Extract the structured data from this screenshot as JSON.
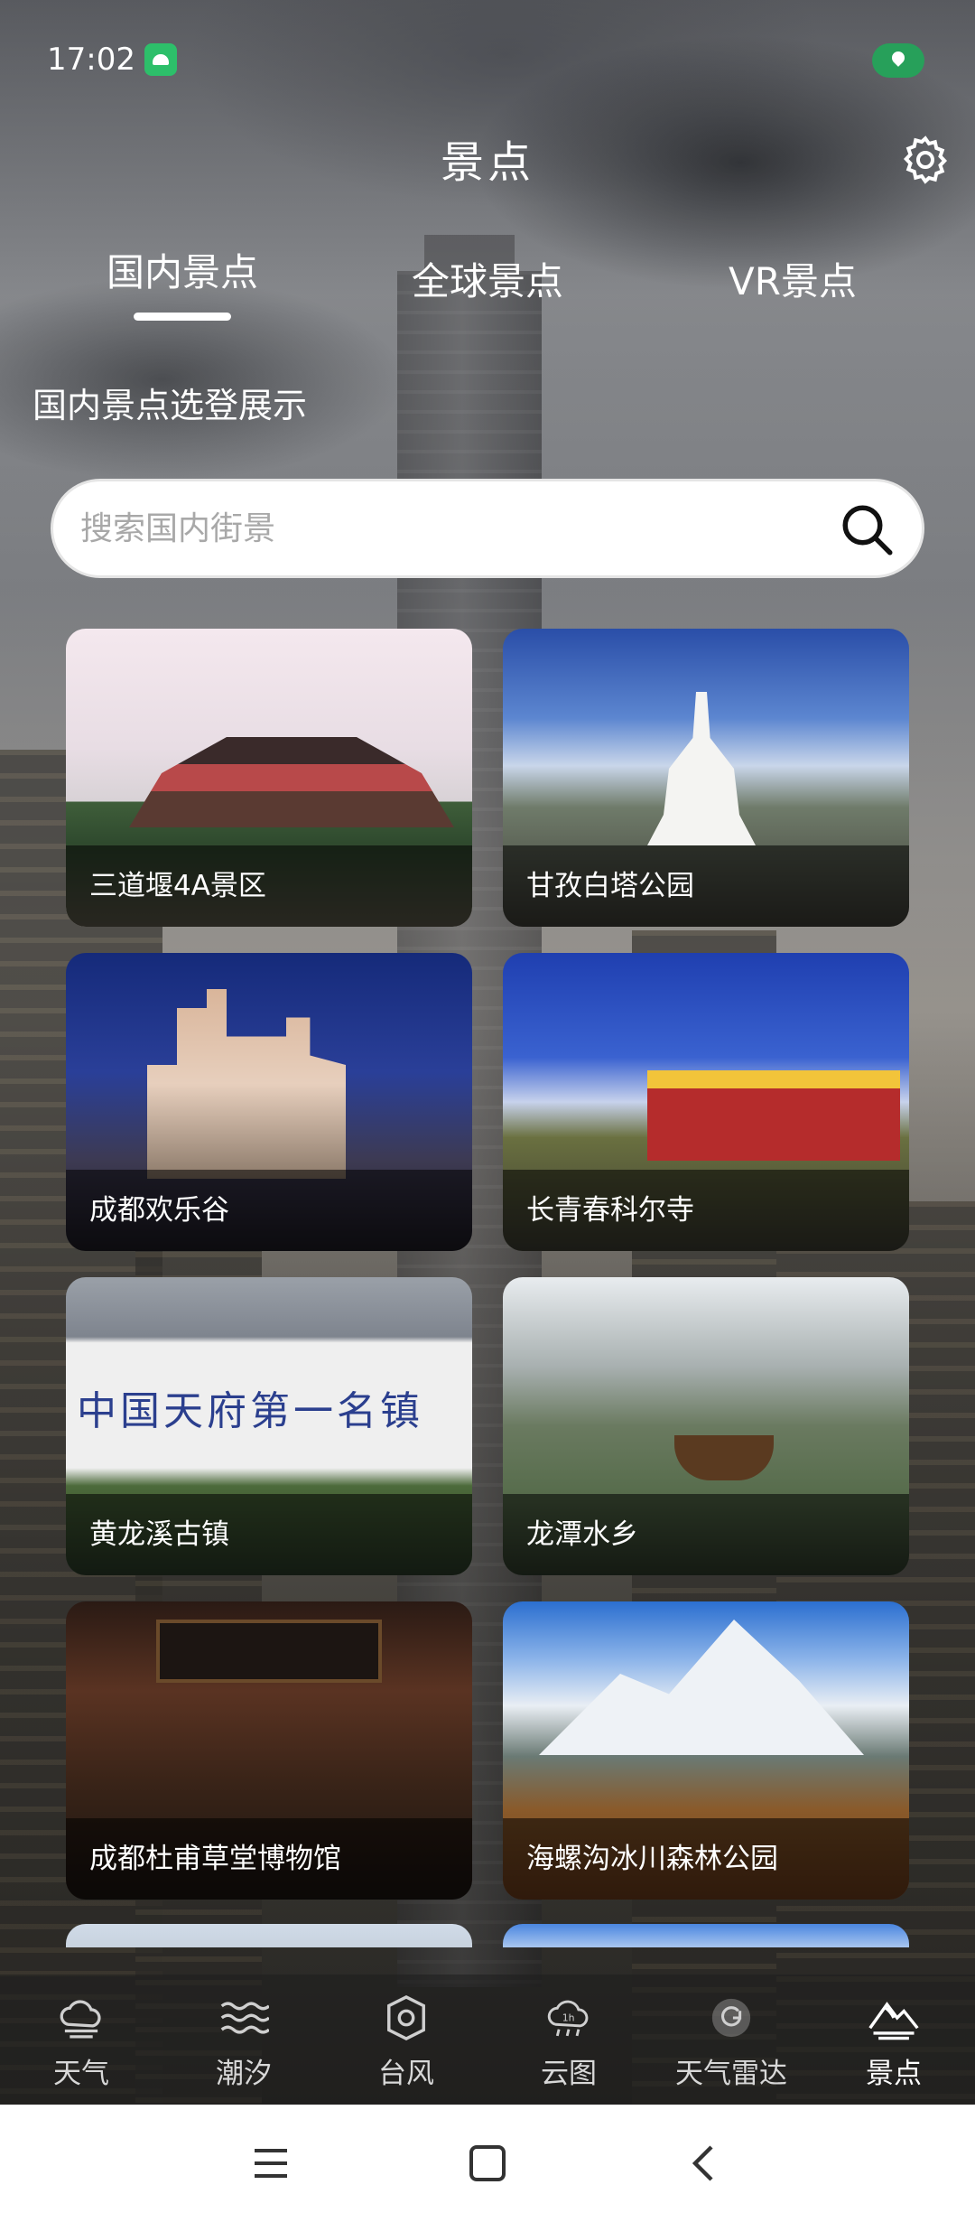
{
  "status_bar": {
    "time": "17:02",
    "app_icon": "android-icon",
    "right_indicator": "location-pill-icon",
    "indicator_color": "#27a05a"
  },
  "header": {
    "title": "景点",
    "settings_icon": "gear-icon"
  },
  "tabs": [
    {
      "label": "国内景点",
      "active": true
    },
    {
      "label": "全球景点",
      "active": false
    },
    {
      "label": "VR景点",
      "active": false
    }
  ],
  "section": {
    "subtitle": "国内景点选登展示"
  },
  "search": {
    "value": "",
    "placeholder": "搜索国内街景",
    "icon": "search-icon"
  },
  "cards": [
    {
      "name": "三道堰4A景区"
    },
    {
      "name": "甘孜白塔公园"
    },
    {
      "name": "成都欢乐谷"
    },
    {
      "name": "长青春科尔寺"
    },
    {
      "name": "黄龙溪古镇",
      "image_text": "中国天府第一名镇"
    },
    {
      "name": "龙潭水乡"
    },
    {
      "name": "成都杜甫草堂博物馆"
    },
    {
      "name": "海螺沟冰川森林公园"
    }
  ],
  "bottom_nav": [
    {
      "label": "天气",
      "icon": "cloud-icon",
      "active": false
    },
    {
      "label": "潮汐",
      "icon": "waves-icon",
      "active": false
    },
    {
      "label": "台风",
      "icon": "typhoon-icon",
      "active": false
    },
    {
      "label": "云图",
      "icon": "cloud-rain-1h-icon",
      "active": false
    },
    {
      "label": "天气雷达",
      "icon": "radar-icon",
      "active": false
    },
    {
      "label": "景点",
      "icon": "mountain-icon",
      "active": true
    }
  ],
  "system_nav": [
    "menu-icon",
    "home-icon",
    "back-icon"
  ]
}
